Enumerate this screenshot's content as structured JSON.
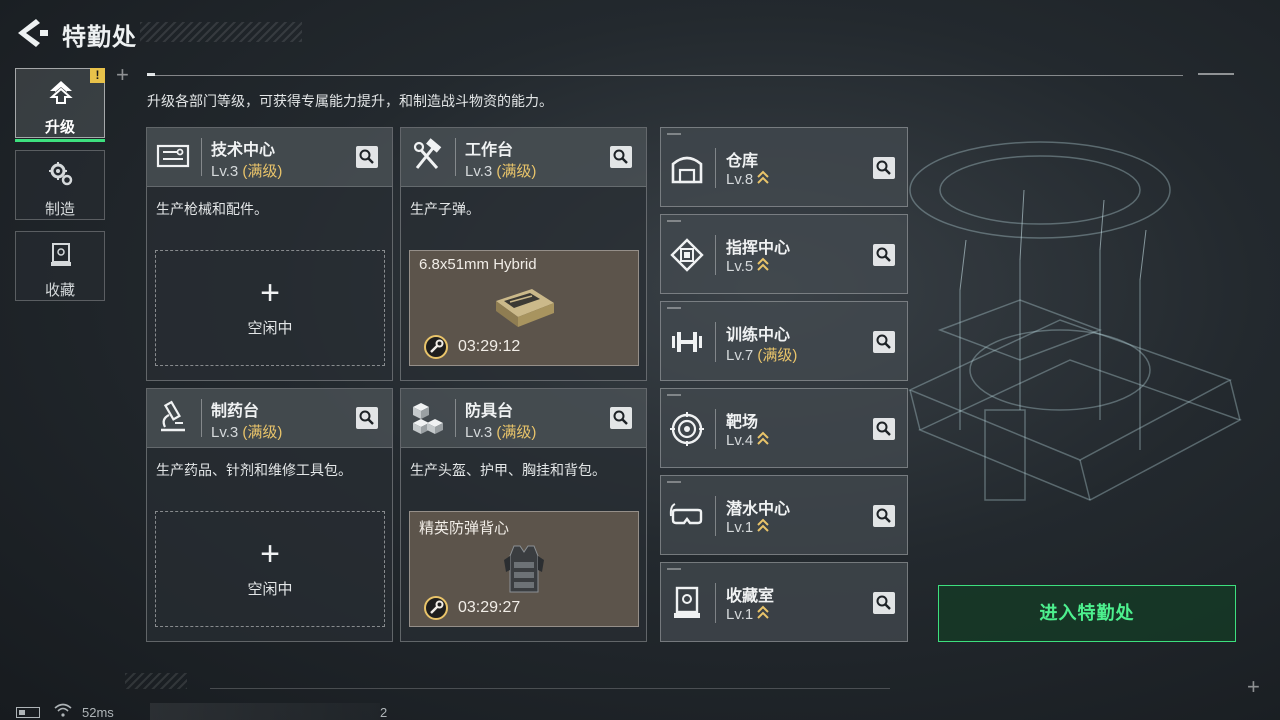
{
  "header": {
    "title": "特勤处",
    "subtitle": "升级各部门等级，可获得专属能力提升，和制造战斗物资的能力。"
  },
  "sidebar": {
    "items": [
      {
        "label": "升级",
        "icon": "upgrade-icon",
        "active": true,
        "badge": "!"
      },
      {
        "label": "制造",
        "icon": "gears-icon",
        "active": false
      },
      {
        "label": "收藏",
        "icon": "collection-icon",
        "active": false
      }
    ]
  },
  "cards": [
    {
      "name": "技术中心",
      "level": "Lv.3",
      "max_tag": "(满级)",
      "desc": "生产枪械和配件。",
      "icon": "tech-center-icon",
      "state": "idle",
      "idle_label": "空闲中"
    },
    {
      "name": "工作台",
      "level": "Lv.3",
      "max_tag": "(满级)",
      "desc": "生产子弹。",
      "icon": "hammer-wrench-icon",
      "state": "producing",
      "item_name": "6.8x51mm Hybrid",
      "timer": "03:29:12"
    },
    {
      "name": "制药台",
      "level": "Lv.3",
      "max_tag": "(满级)",
      "desc": "生产药品、针剂和维修工具包。",
      "icon": "microscope-icon",
      "state": "idle",
      "idle_label": "空闲中"
    },
    {
      "name": "防具台",
      "level": "Lv.3",
      "max_tag": "(满级)",
      "desc": "生产头盔、护甲、胸挂和背包。",
      "icon": "cubes-icon",
      "state": "producing",
      "item_name": "精英防弹背心",
      "timer": "03:29:27"
    }
  ],
  "facilities": [
    {
      "name": "仓库",
      "level": "Lv.8",
      "max_tag": "",
      "icon": "warehouse-icon",
      "upgradable": true
    },
    {
      "name": "指挥中心",
      "level": "Lv.5",
      "max_tag": "",
      "icon": "chip-icon",
      "upgradable": true
    },
    {
      "name": "训练中心",
      "level": "Lv.7",
      "max_tag": "(满级)",
      "icon": "dumbbell-icon",
      "upgradable": false
    },
    {
      "name": "靶场",
      "level": "Lv.4",
      "max_tag": "",
      "icon": "target-icon",
      "upgradable": true
    },
    {
      "name": "潜水中心",
      "level": "Lv.1",
      "max_tag": "",
      "icon": "goggles-icon",
      "upgradable": true
    },
    {
      "name": "收藏室",
      "level": "Lv.1",
      "max_tag": "",
      "icon": "display-case-icon",
      "upgradable": true
    }
  ],
  "enter_button": "进入特勤处",
  "status_bar": {
    "ping": "52ms",
    "page": "2"
  },
  "colors": {
    "accent_green": "#3de07e",
    "max_level_gold": "#e9c46a",
    "badge_yellow": "#e8c24a"
  }
}
